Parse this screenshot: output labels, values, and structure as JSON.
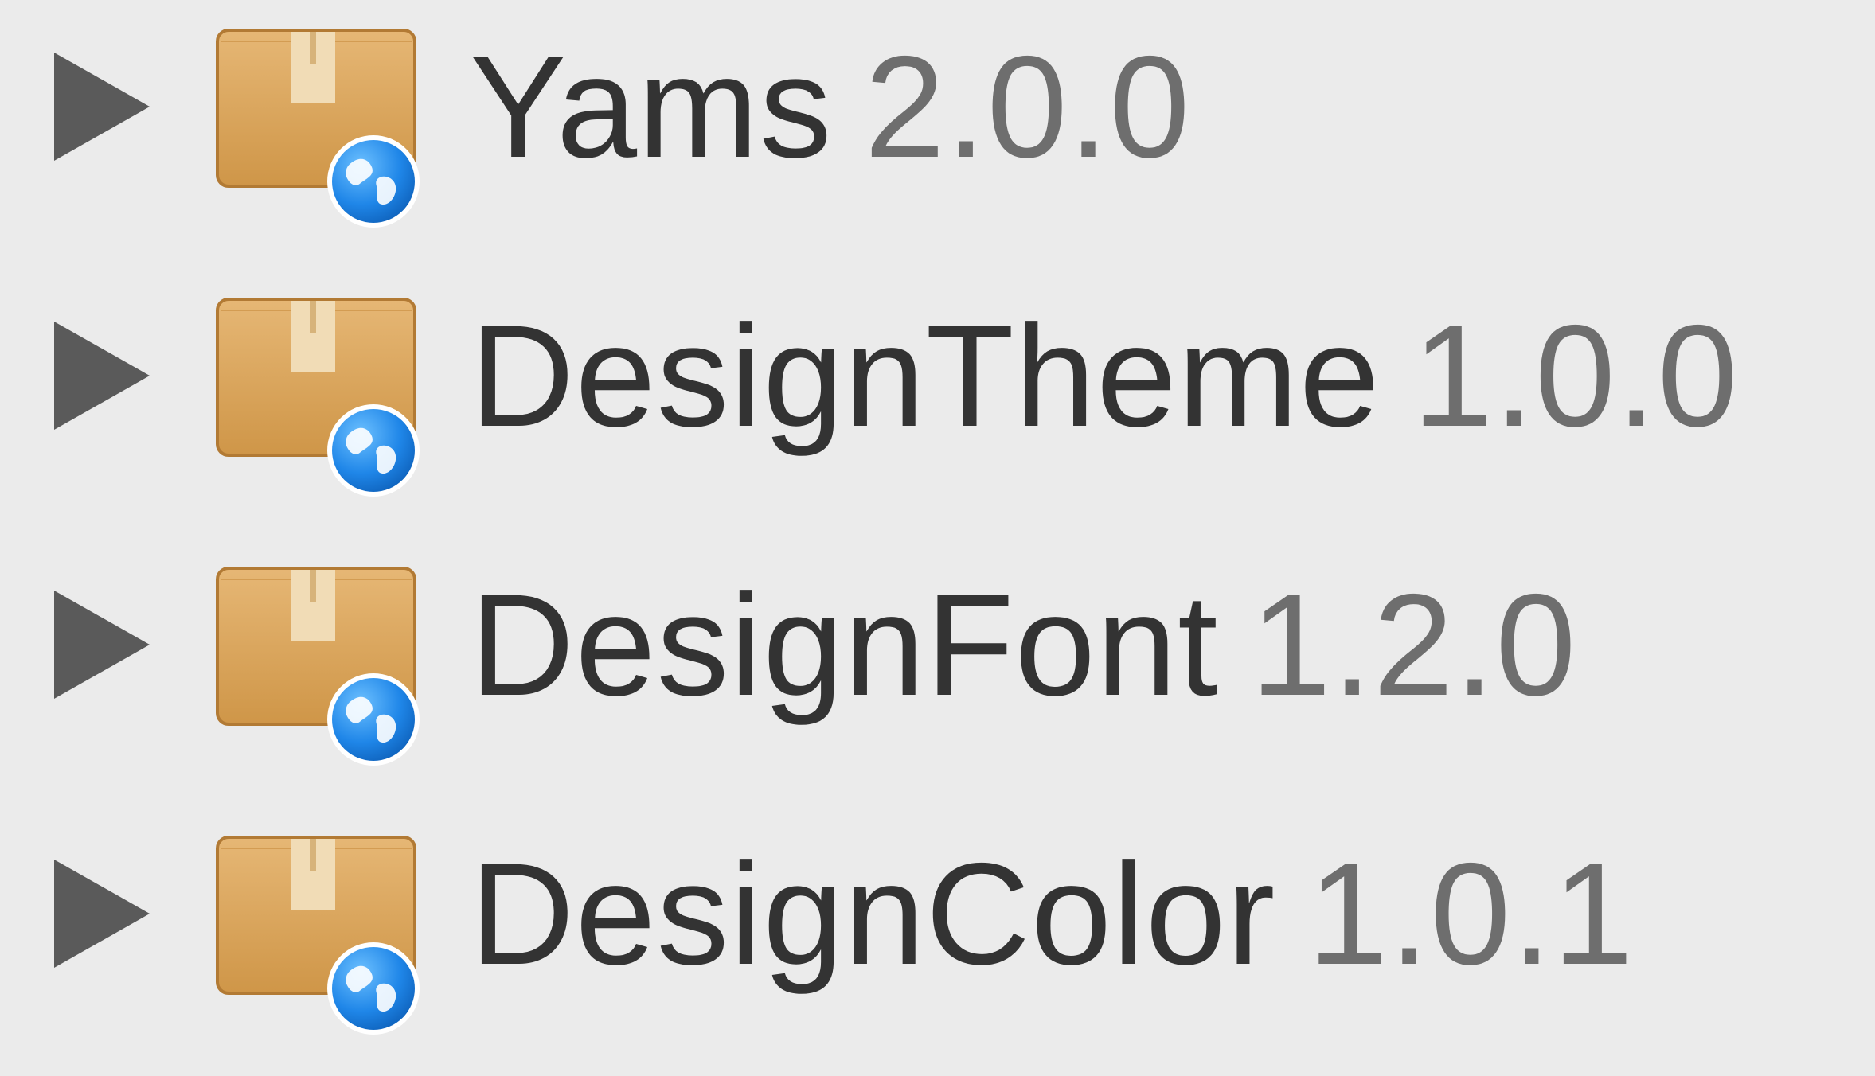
{
  "packages": [
    {
      "name": "Yams",
      "version": "2.0.0"
    },
    {
      "name": "DesignTheme",
      "version": "1.0.0"
    },
    {
      "name": "DesignFont",
      "version": "1.2.0"
    },
    {
      "name": "DesignColor",
      "version": "1.0.1"
    }
  ],
  "icons": {
    "disclosure": "disclosure-triangle-right-icon",
    "package": "package-box-globe-icon"
  },
  "colors": {
    "background": "#ebebeb",
    "name_text": "#333333",
    "version_text": "#6e6e6e",
    "disclosure": "#5a5a5a",
    "box": "#d9a25a",
    "globe": "#1e88e5"
  }
}
